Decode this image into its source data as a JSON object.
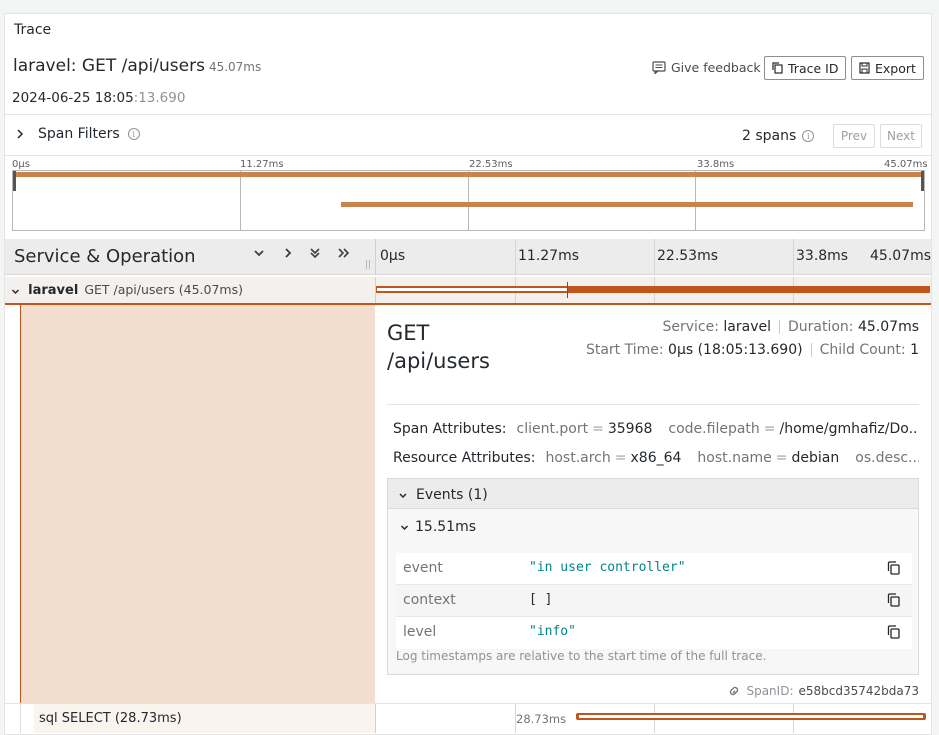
{
  "header": {
    "section_title": "Trace",
    "trace_name": "laravel: GET /api/users",
    "trace_duration": "45.07ms",
    "start_date": "2024-06-25 18:05",
    "start_ms": ":13.690",
    "feedback_label": "Give feedback",
    "trace_id_label": "Trace ID",
    "export_label": "Export"
  },
  "filters": {
    "label": "Span Filters",
    "span_count": "2 spans",
    "prev_label": "Prev",
    "next_label": "Next"
  },
  "minimap": {
    "ticks": [
      "0μs",
      "11.27ms",
      "22.53ms",
      "33.8ms",
      "45.07ms"
    ]
  },
  "timeline_header": {
    "title": "Service & Operation",
    "ticks": [
      "0μs",
      "11.27ms",
      "22.53ms",
      "33.8ms",
      "45.07ms"
    ]
  },
  "spans": [
    {
      "service": "laravel",
      "operation": "GET /api/users (45.07ms)",
      "start_fraction": 0,
      "duration_fraction": 1
    },
    {
      "label": "sql SELECT (28.73ms)",
      "time_label": "28.73ms",
      "start_fraction": 0.36,
      "duration_fraction": 0.637
    }
  ],
  "detail": {
    "operation_line1": "GET",
    "operation_line2": "/api/users",
    "service_label": "Service:",
    "service_value": "laravel",
    "duration_label": "Duration:",
    "duration_value": "45.07ms",
    "start_label": "Start Time:",
    "start_value": "0μs (18:05:13.690)",
    "child_label": "Child Count:",
    "child_value": "1",
    "span_attributes": {
      "label": "Span Attributes:",
      "items": [
        {
          "key": "client.port",
          "value": "35968"
        },
        {
          "key": "code.filepath",
          "value": "/home/gmhafiz/Do..."
        }
      ]
    },
    "resource_attributes": {
      "label": "Resource Attributes:",
      "items": [
        {
          "key": "host.arch",
          "value": "x86_64"
        },
        {
          "key": "host.name",
          "value": "debian"
        },
        {
          "key": "os.desc...",
          "value": ""
        }
      ]
    },
    "events": {
      "header": "Events (1)",
      "time": "15.51ms",
      "rows": [
        {
          "key": "event",
          "value": "\"in user controller\""
        },
        {
          "key": "context",
          "value": "[ ]"
        },
        {
          "key": "level",
          "value": "\"info\""
        }
      ],
      "note": "Log timestamps are relative to the start time of the full trace."
    },
    "span_id_label": "SpanID:",
    "span_id_value": "e58bcd35742bda73"
  }
}
